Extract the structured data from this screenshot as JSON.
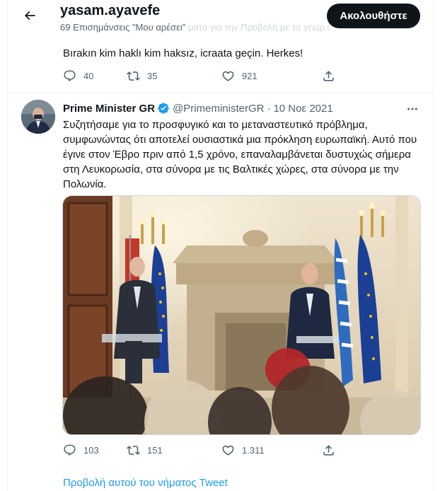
{
  "header": {
    "profile_name": "yasam.ayavefe",
    "likes_count_label": "69 Επισημάνσεις \"Μου αρέσει\"",
    "faded_text": "ματα για την Προβολή με τα γεωρ.ι",
    "follow_label": "Ακολουθήστε"
  },
  "tweet1": {
    "text": "Bırakın kim haklı kim haksız, icraata geçin. Herkes!",
    "replies": "40",
    "retweets": "35",
    "likes": "921"
  },
  "tweet2": {
    "author_name": "Prime Minister GR",
    "handle": "@PrimeministerGR",
    "separator": "·",
    "date": "10 Νοε 2021",
    "text": "Συζητήσαμε για το προσφυγικό και το μεταναστευτικό πρόβλημα, συμφωνώντας ότι αποτελεί ουσιαστικά μια πρόκληση ευρωπαϊκή. Αυτό που έγινε στον Έβρο πριν από 1,5 χρόνο, επαναλαμβάνεται δυστυχώς σήμερα στη Λευκορωσία, στα σύνορα με τις Βαλτικές χώρες, στα σύνορα με την Πολωνία.",
    "replies": "103",
    "retweets": "151",
    "likes": "1.311",
    "thread_link": "Προβολή αυτού του νήματος Tweet"
  },
  "colors": {
    "accent": "#1d9bf0",
    "muted": "#536471",
    "text": "#0f1419",
    "divider": "#eff3f4"
  },
  "icons": [
    "back-arrow-icon",
    "reply-icon",
    "retweet-icon",
    "like-icon",
    "share-icon",
    "verified-badge-icon",
    "more-icon"
  ]
}
